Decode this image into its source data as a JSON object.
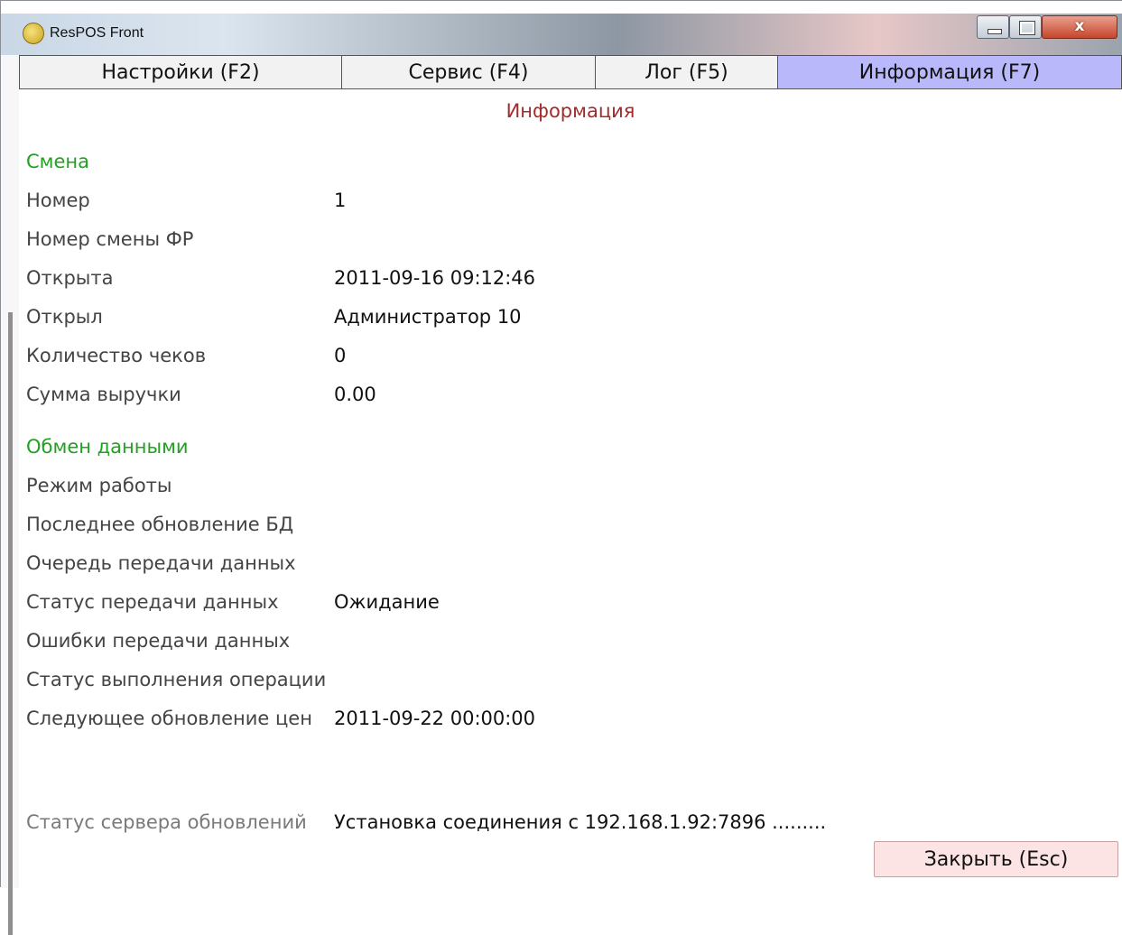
{
  "window": {
    "title": "ResPOS Front"
  },
  "tabs": [
    {
      "label": "Настройки (F2)",
      "active": false
    },
    {
      "label": "Сервис (F4)",
      "active": false
    },
    {
      "label": "Лог (F5)",
      "active": false
    },
    {
      "label": "Информация (F7)",
      "active": true
    }
  ],
  "panel": {
    "title": "Информация"
  },
  "shift": {
    "heading": "Смена",
    "rows": [
      {
        "label": "Номер",
        "value": "1"
      },
      {
        "label": "Номер смены ФР",
        "value": ""
      },
      {
        "label": "Открыта",
        "value": "2011-09-16 09:12:46"
      },
      {
        "label": "Открыл",
        "value": "Администратор 10"
      },
      {
        "label": "Количество чеков",
        "value": "0"
      },
      {
        "label": "Сумма выручки",
        "value": "0.00"
      }
    ]
  },
  "exchange": {
    "heading": "Обмен данными",
    "rows": [
      {
        "label": "Режим работы",
        "value": ""
      },
      {
        "label": "Последнее обновление БД",
        "value": ""
      },
      {
        "label": "Очередь передачи данных",
        "value": ""
      },
      {
        "label": "Статус передачи данных",
        "value": "Ожидание"
      },
      {
        "label": "Ошибки передачи данных",
        "value": ""
      },
      {
        "label": "Статус выполнения операции",
        "value": ""
      },
      {
        "label": "Следующее обновление цен",
        "value": "2011-09-22 00:00:00"
      }
    ]
  },
  "update_server": {
    "label": "Статус сервера обновлений",
    "value": "Установка соединения с 192.168.1.92:7896 ........."
  },
  "close_button": {
    "label": "Закрыть (Esc)"
  },
  "colors": {
    "active_tab": "#b8b8fb",
    "section_heading": "#21a121",
    "panel_title": "#a52a2a",
    "close_button_bg": "#fde4e4"
  }
}
